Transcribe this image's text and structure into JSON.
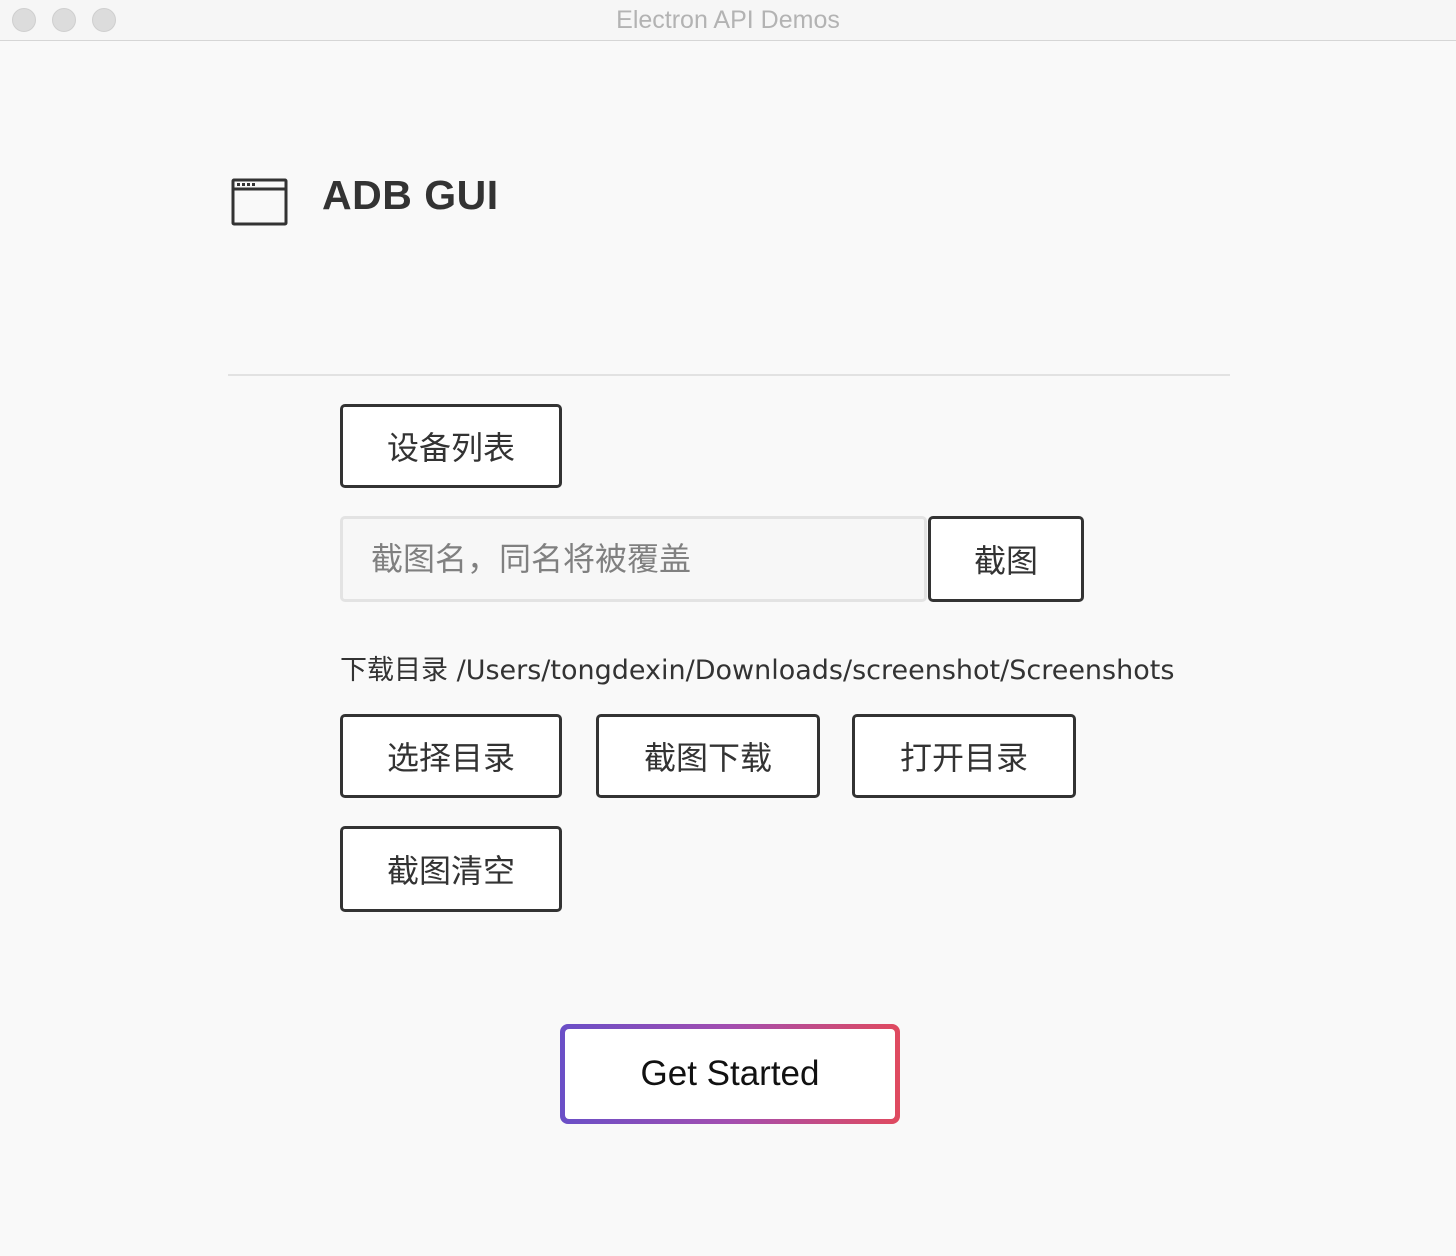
{
  "window": {
    "title": "Electron API Demos"
  },
  "header": {
    "title": "ADB GUI",
    "icon": "window-icon"
  },
  "actions": {
    "devices_label": "设备列表",
    "screenshot_name_placeholder": "截图名，同名将被覆盖",
    "screenshot_name_value": "",
    "capture_label": "截图",
    "download_dir_label": "下载目录",
    "download_dir_path": "/Users/tongdexin/Downloads/screenshot/Screenshots",
    "choose_dir_label": "选择目录",
    "download_screenshots_label": "截图下载",
    "open_dir_label": "打开目录",
    "clear_screenshots_label": "截图清空"
  },
  "footer": {
    "get_started_label": "Get Started"
  },
  "colors": {
    "gradient_start": "#6a4fc7",
    "gradient_end": "#e04a5f",
    "text": "#333333"
  }
}
